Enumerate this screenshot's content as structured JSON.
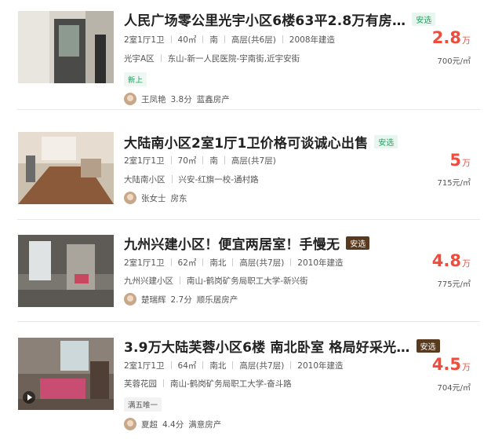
{
  "listings": [
    {
      "title": "人民广场零公里光宇小区6楼63平2.8万有房…",
      "tag": "安选",
      "layout": "2室1厅1卫",
      "area": "40㎡",
      "orientation": "南",
      "floor": "高层(共6层)",
      "year": "2008年建造",
      "community": "光宇A区",
      "location": "东山-新一人民医院-宇南街,近宇安街",
      "feature": "新上",
      "agent_name": "王凤艳",
      "agent_score": "3.8分",
      "agent_company": "蓝鑫房产",
      "price": "2.8",
      "price_unit": "万",
      "unit_price": "700元/㎡"
    },
    {
      "title": "大陆南小区2室1厅1卫价格可谈诚心出售",
      "tag": "安选",
      "layout": "2室1厅1卫",
      "area": "70㎡",
      "orientation": "南",
      "floor": "高层(共7层)",
      "community": "大陆南小区",
      "location": "兴安-红旗一校-通村路",
      "agent_name": "张女士",
      "agent_company": "房东",
      "price": "5",
      "price_unit": "万",
      "unit_price": "715元/㎡"
    },
    {
      "title": "九州兴建小区！便宜两居室！手慢无",
      "tag": "安选",
      "layout": "2室1厅1卫",
      "area": "62㎡",
      "orientation": "南北",
      "floor": "高层(共7层)",
      "year": "2010年建造",
      "community": "九州兴建小区",
      "location": "南山-鹤岗矿务局职工大学-新兴街",
      "agent_name": "楚瑞辉",
      "agent_score": "2.7分",
      "agent_company": "顺乐居房产",
      "price": "4.8",
      "price_unit": "万",
      "unit_price": "775元/㎡"
    },
    {
      "title": "3.9万大陆芙蓉小区6楼 南北卧室 格局好采光…",
      "tag": "安选",
      "layout": "2室1厅1卫",
      "area": "64㎡",
      "orientation": "南北",
      "floor": "高层(共7层)",
      "year": "2010年建造",
      "community": "芙蓉花园",
      "location": "南山-鹤岗矿务局职工大学-奋斗路",
      "feature": "满五唯一",
      "agent_name": "夏超",
      "agent_score": "4.4分",
      "agent_company": "满意房产",
      "price": "4.5",
      "price_unit": "万",
      "unit_price": "704元/㎡"
    }
  ]
}
